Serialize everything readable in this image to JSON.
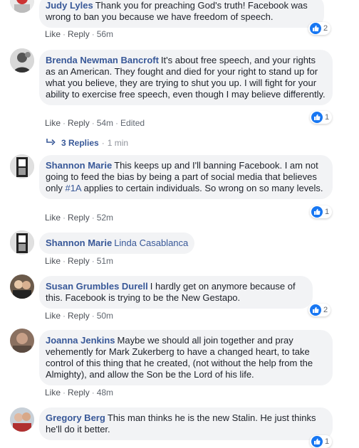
{
  "comments": [
    {
      "author": "Judy Lyles",
      "text": "Thank you for preaching God's truth! Facebook was wrong to ban you because we have freedom of speech.",
      "like": "Like",
      "reply": "Reply",
      "time": "56m",
      "edited": "",
      "reactions": "2"
    },
    {
      "author": "Brenda Newman Bancroft",
      "text": "It's about free speech, and your rights as an American. They fought and died for your right to stand up for what you believe, they are trying to shut you up. I will fight for your ability to exercise free speech, even though I may believe differently.",
      "like": "Like",
      "reply": "Reply",
      "time": "54m",
      "edited": "Edited",
      "reactions": "1",
      "replies_label": "3 Replies",
      "replies_time": "1 min"
    },
    {
      "author": "Shannon Marie",
      "text_before": "This keeps up and I'll banning Facebook. I am not going to feed the bias by being a part of social media that believes only ",
      "hashtag": "#1A",
      "text_after": " applies to certain individuals. So wrong on so many levels.",
      "like": "Like",
      "reply": "Reply",
      "time": "52m",
      "reactions": "1"
    },
    {
      "author": "Shannon Marie",
      "tagged": "Linda Casablanca",
      "like": "Like",
      "reply": "Reply",
      "time": "51m"
    },
    {
      "author": "Susan Grumbles Durell",
      "text": "I hardly get on anymore because of this. Facebook is trying to be the New Gestapo.",
      "like": "Like",
      "reply": "Reply",
      "time": "50m",
      "reactions": "2"
    },
    {
      "author": "Joanna Jenkins",
      "text": "Maybe we should all join together and pray vehemently for Mark Zukerberg to have a changed heart, to take control of this thing that he created, (not without the help from the Almighty), and allow the Son be the Lord of his life.",
      "like": "Like",
      "reply": "Reply",
      "time": "48m"
    },
    {
      "author": "Gregory Berg",
      "text": "This man thinks he is the new Stalin. He just thinks he'll do it better.",
      "reactions": "1"
    }
  ],
  "colors": {
    "link": "#385898",
    "bubble": "#f2f3f5",
    "like_blue": "#1877f2"
  },
  "icons": [
    "avatar",
    "like-icon",
    "reply-arrow-icon"
  ]
}
